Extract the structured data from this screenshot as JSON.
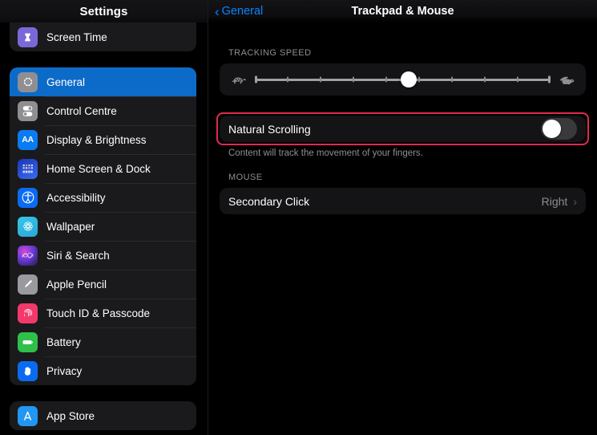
{
  "sidebar": {
    "title": "Settings",
    "groups": [
      {
        "name": "group-top",
        "items": [
          {
            "label": "Screen Time",
            "icon": "hourglass-icon",
            "icon_class": "ic-screen-time",
            "glyph": "⌛",
            "selected": false
          }
        ]
      },
      {
        "name": "group-system",
        "items": [
          {
            "label": "General",
            "icon": "gear-icon",
            "icon_class": "ic-general",
            "glyph": "⚙",
            "selected": true
          },
          {
            "label": "Control Centre",
            "icon": "toggles-icon",
            "icon_class": "ic-control",
            "glyph": "⚇",
            "selected": false
          },
          {
            "label": "Display & Brightness",
            "icon": "aa-text-icon",
            "icon_class": "ic-display",
            "glyph": "AA",
            "selected": false
          },
          {
            "label": "Home Screen & Dock",
            "icon": "home-grid-icon",
            "icon_class": "ic-home",
            "glyph": "▦",
            "selected": false
          },
          {
            "label": "Accessibility",
            "icon": "accessibility-icon",
            "icon_class": "ic-access",
            "glyph": "Ⓙ",
            "selected": false
          },
          {
            "label": "Wallpaper",
            "icon": "wallpaper-flower-icon",
            "icon_class": "ic-wallpaper",
            "glyph": "✿",
            "selected": false
          },
          {
            "label": "Siri & Search",
            "icon": "siri-orb-icon",
            "icon_class": "ic-siri",
            "glyph": "✶",
            "selected": false
          },
          {
            "label": "Apple Pencil",
            "icon": "pencil-icon",
            "icon_class": "ic-pencil",
            "glyph": "╱",
            "selected": false
          },
          {
            "label": "Touch ID & Passcode",
            "icon": "fingerprint-icon",
            "icon_class": "ic-touchid",
            "glyph": "◔",
            "selected": false
          },
          {
            "label": "Battery",
            "icon": "battery-icon",
            "icon_class": "ic-battery",
            "glyph": "▬",
            "selected": false
          },
          {
            "label": "Privacy",
            "icon": "hand-icon",
            "icon_class": "ic-privacy",
            "glyph": "✋",
            "selected": false
          }
        ]
      },
      {
        "name": "group-stores",
        "items": [
          {
            "label": "App Store",
            "icon": "app-store-icon",
            "icon_class": "ic-appstore",
            "glyph": "Ⓐ",
            "selected": false
          }
        ]
      }
    ]
  },
  "detail": {
    "back_label": "General",
    "back_icon": "chevron-left-icon",
    "title": "Trackpad & Mouse",
    "sections": [
      {
        "header": "TRACKING SPEED",
        "slider": {
          "name": "tracking-speed-slider",
          "left_icon": "tortoise-icon",
          "right_icon": "hare-icon",
          "min": 0,
          "max": 9,
          "value": 5,
          "ticks": 10,
          "percent": 52
        }
      },
      {
        "header": "",
        "toggle": {
          "label": "Natural Scrolling",
          "state": "off",
          "highlighted": true,
          "highlight_color": "#e02a4e"
        },
        "footnote": "Content will track the movement of your fingers."
      },
      {
        "header": "MOUSE",
        "row": {
          "label": "Secondary Click",
          "value": "Right",
          "chevron": "chevron-right-icon"
        }
      }
    ]
  },
  "colors": {
    "accent_blue": "#0a84ff",
    "selected_row": "#0c6bc9",
    "card_bg": "#141416",
    "sidebar_card_bg": "#1a1a1c",
    "highlight_red": "#e02a4e",
    "secondary_text": "#8e8e93"
  }
}
